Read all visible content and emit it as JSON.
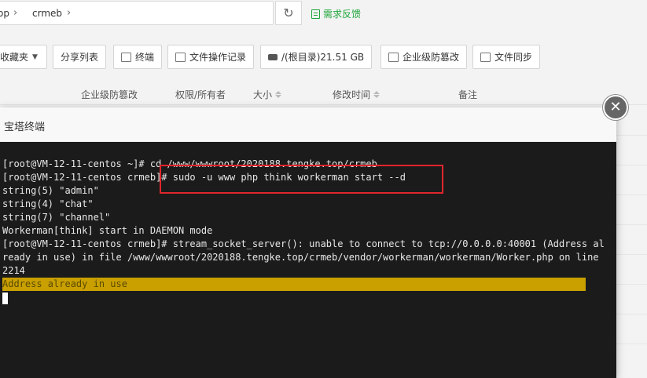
{
  "breadcrumb": {
    "seg1": "op",
    "seg2": "crmeb"
  },
  "feedback_label": "需求反馈",
  "toolbar": {
    "fav_label": "收藏夹",
    "share_label": "分享列表",
    "terminal_label": "终端",
    "oplog_label": "文件操作记录",
    "disk_label": "/(根目录)21.51 GB",
    "tamper_label": "企业级防篡改",
    "sync_label": "文件同步"
  },
  "table_header": {
    "tamper": "企业级防篡改",
    "perm": "权限/所有者",
    "size": "大小",
    "mtime": "修改时间",
    "note": "备注"
  },
  "modal": {
    "title": "宝塔终端",
    "close_glyph": "✕"
  },
  "terminal_lines": [
    "[root@VM-12-11-centos ~]# cd /www/wwwroot/2020188.tengke.top/crmeb",
    "[root@VM-12-11-centos crmeb]# sudo -u www php think workerman start --d",
    "string(5) \"admin\"",
    "string(4) \"chat\"",
    "string(7) \"channel\"",
    "Workerman[think] start in DAEMON mode",
    "[root@VM-12-11-centos crmeb]# stream_socket_server(): unable to connect to tcp://0.0.0.0:40001 (Address al",
    "ready in use) in file /www/wwwroot/2020188.tengke.top/crmeb/vendor/workerman/workerman/Worker.php on line",
    "2214"
  ],
  "terminal_highlight": "Address already in use",
  "colors": {
    "accent": "#20a53a",
    "highlight": "#c9a000",
    "annotation": "#e0262b",
    "terminal_bg": "#1b1b1b"
  }
}
